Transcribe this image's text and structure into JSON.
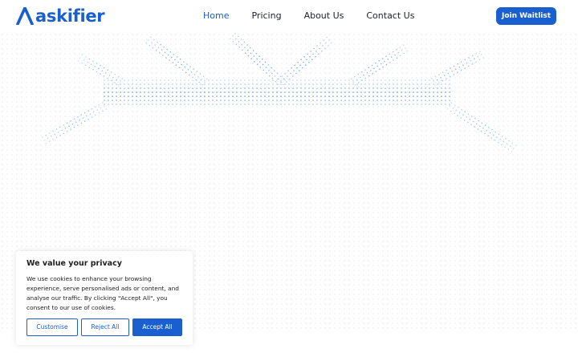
{
  "brand": {
    "name": "askifier",
    "logo_icon": "a-logo-icon",
    "color": "#1a5fd0"
  },
  "nav": {
    "items": [
      {
        "label": "Home",
        "active": true
      },
      {
        "label": "Pricing",
        "active": false
      },
      {
        "label": "About Us",
        "active": false
      },
      {
        "label": "Contact Us",
        "active": false
      }
    ],
    "cta_label": "Join Waitlist"
  },
  "hero": {
    "decoration": "dotted-wave-pattern",
    "dot_color": "#2a7ad6"
  },
  "cookie_banner": {
    "title": "We value your privacy",
    "body": "We use cookies to enhance your browsing experience, serve personalised ads or content, and analyse our traffic. By clicking \"Accept All\", you consent to our use of cookies.",
    "buttons": {
      "customise": "Customise",
      "reject": "Reject All",
      "accept": "Accept All"
    }
  }
}
